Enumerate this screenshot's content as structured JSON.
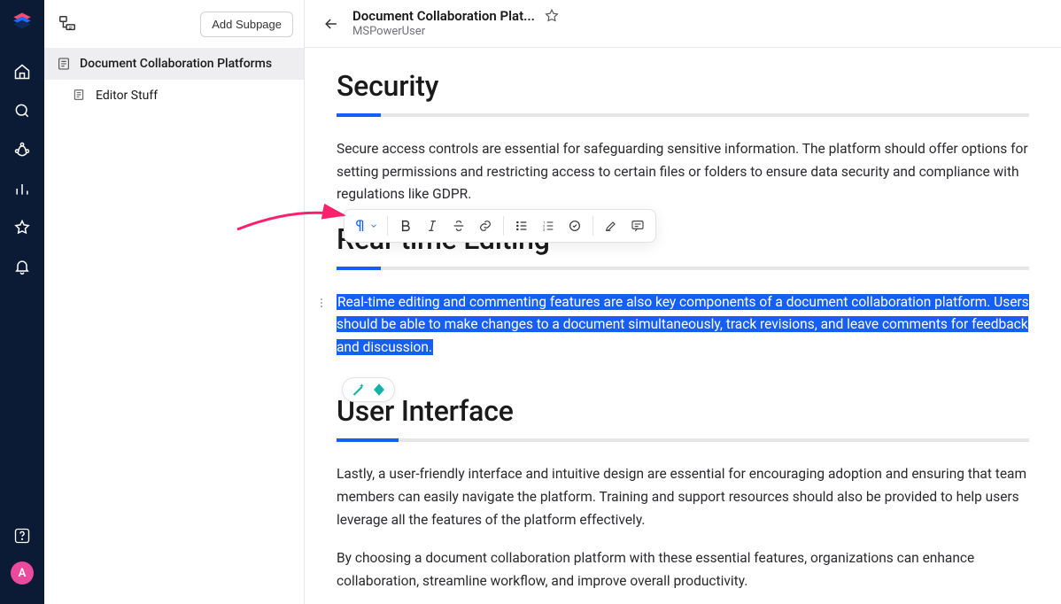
{
  "rail": {
    "avatar_initial": "A"
  },
  "sidebar": {
    "add_subpage_label": "Add Subpage",
    "items": [
      {
        "label": "Document Collaboration Platforms"
      },
      {
        "label": "Editor Stuff"
      }
    ]
  },
  "header": {
    "title": "Document Collaboration Plat...",
    "subtitle": "MSPowerUser"
  },
  "doc": {
    "sections": [
      {
        "heading": "Security",
        "paras": [
          "Secure access controls are essential for safeguarding sensitive information. The platform should offer options for setting permissions and restricting access to certain files or folders to ensure data security and compliance with regulations like GDPR."
        ]
      },
      {
        "heading": "Real-time Editing",
        "paras": [
          "Real-time editing and commenting features are also key components of a document collaboration platform. Users should be able to make changes to a document simultaneously, track revisions, and leave comments for feedback and discussion."
        ]
      },
      {
        "heading": "User Interface",
        "paras": [
          "Lastly, a user-friendly interface and intuitive design are essential for encouraging adoption and ensuring that team members can easily navigate the platform. Training and support resources should also be provided to help users leverage all the features of the platform effectively.",
          "By choosing a document collaboration platform with these essential features, organizations can enhance collaboration, streamline workflow, and improve overall productivity."
        ]
      }
    ]
  }
}
